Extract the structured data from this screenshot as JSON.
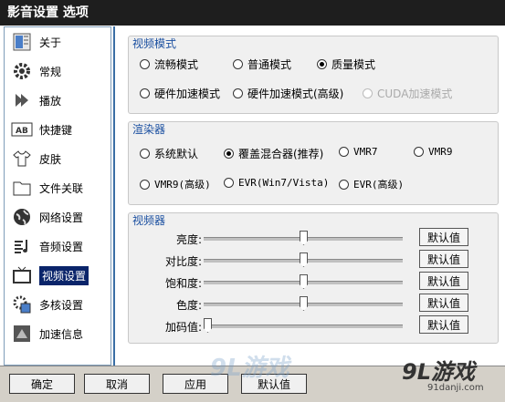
{
  "window": {
    "title": "影音设置 选项"
  },
  "sidebar": {
    "items": [
      {
        "label": "关于",
        "icon": "info-icon"
      },
      {
        "label": "常规",
        "icon": "gear-icon"
      },
      {
        "label": "播放",
        "icon": "play-arrow-icon"
      },
      {
        "label": "快捷键",
        "icon": "keyboard-icon"
      },
      {
        "label": "皮肤",
        "icon": "shirt-icon"
      },
      {
        "label": "文件关联",
        "icon": "folder-icon"
      },
      {
        "label": "网络设置",
        "icon": "globe-icon"
      },
      {
        "label": "音频设置",
        "icon": "audio-icon"
      },
      {
        "label": "视频设置",
        "icon": "tv-icon"
      },
      {
        "label": "多核设置",
        "icon": "chip-icon"
      },
      {
        "label": "加速信息",
        "icon": "nvidia-icon"
      }
    ],
    "active": "视频设置"
  },
  "video_mode": {
    "title": "视频模式",
    "options": [
      "流畅模式",
      "普通模式",
      "质量模式",
      "硬件加速模式",
      "硬件加速模式(高级)",
      "CUDA加速模式"
    ],
    "selected": "质量模式",
    "disabled": [
      "CUDA加速模式"
    ]
  },
  "renderer": {
    "title": "渲染器",
    "options": [
      "系统默认",
      "覆盖混合器(推荐)",
      "VMR7",
      "VMR9",
      "VMR9(高级)",
      "EVR(Win7/Vista)",
      "EVR(高级)"
    ],
    "selected": "覆盖混合器(推荐)"
  },
  "video_adjust": {
    "title": "视频器",
    "sliders": [
      {
        "label": "亮度:",
        "value": 0.5
      },
      {
        "label": "对比度:",
        "value": 0.5
      },
      {
        "label": "饱和度:",
        "value": 0.5
      },
      {
        "label": "色度:",
        "value": 0.5
      },
      {
        "label": "加码值:",
        "value": 0.0
      }
    ],
    "default_label": "默认值"
  },
  "footer": {
    "ok": "确定",
    "cancel": "取消",
    "apply": "应用",
    "default": "默认值"
  },
  "watermark": {
    "brand": "9L游戏",
    "site": "91danji.com",
    "faint": "9L游戏"
  },
  "colors": {
    "titlebar": "#1e1e1e",
    "active_item": "#0a246a",
    "group_title": "#1a4fa0",
    "footer": "#d4d0c8"
  }
}
